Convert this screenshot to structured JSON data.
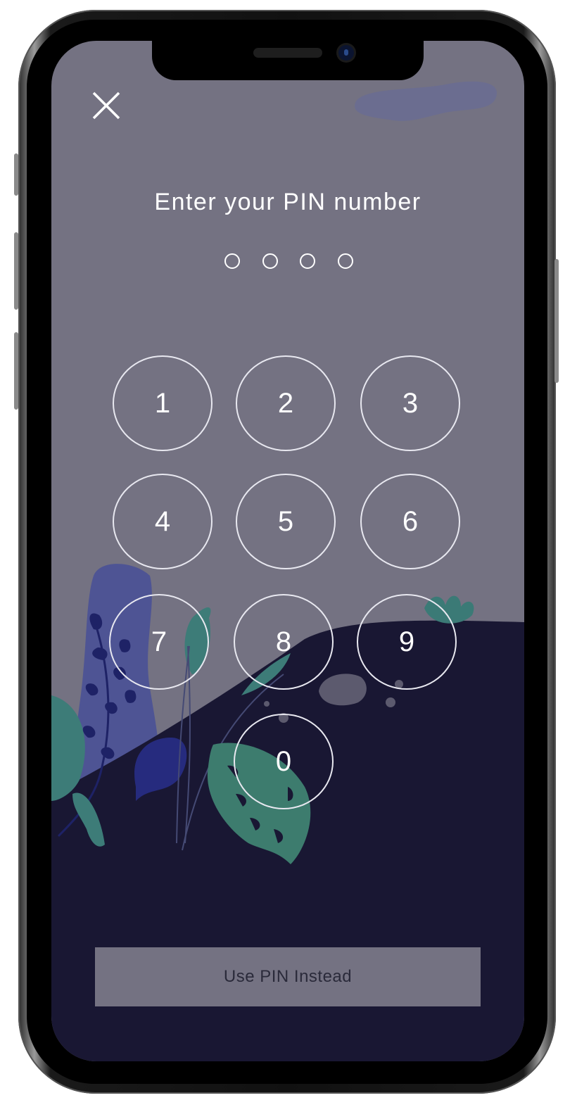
{
  "screen": {
    "title": "Enter your PIN number",
    "pin_length": 4,
    "pin_entered": 0
  },
  "keypad": {
    "keys": [
      "1",
      "2",
      "3",
      "4",
      "5",
      "6",
      "7",
      "8",
      "9",
      "0"
    ]
  },
  "actions": {
    "close_icon": "close-icon",
    "use_pin_label": "Use PIN Instead"
  },
  "colors": {
    "sky": "#747282",
    "hill": "#191733",
    "button_bg": "#747282",
    "text": "#ffffff"
  }
}
